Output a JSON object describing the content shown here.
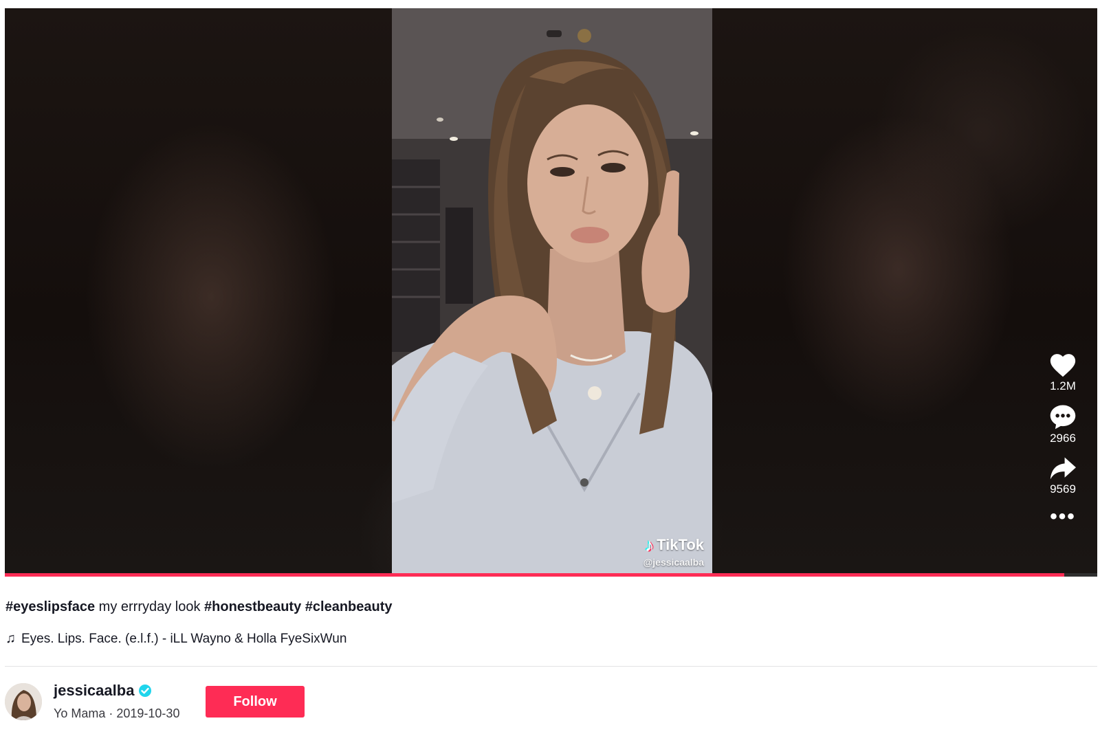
{
  "video": {
    "watermark_brand": "TikTok",
    "watermark_handle": "@jessicaalba",
    "progress_fraction": 0.97
  },
  "actions": {
    "like_count": "1.2M",
    "comment_count": "2966",
    "share_count": "9569",
    "more_label": "•••"
  },
  "caption": {
    "tag1": "#eyeslipsface",
    "text": " my errryday look ",
    "tag2": "#honestbeauty",
    "tag3": "#cleanbeauty"
  },
  "music": {
    "title": "Eyes. Lips. Face. (e.l.f.) - iLL Wayno & Holla FyeSixWun"
  },
  "author": {
    "username": "jessicaalba",
    "nickname": "Yo Mama",
    "date": "2019-10-30",
    "separator": " · "
  },
  "follow_label": "Follow",
  "colors": {
    "accent": "#fe2c55",
    "verified": "#20d5ec",
    "text": "#161823"
  }
}
